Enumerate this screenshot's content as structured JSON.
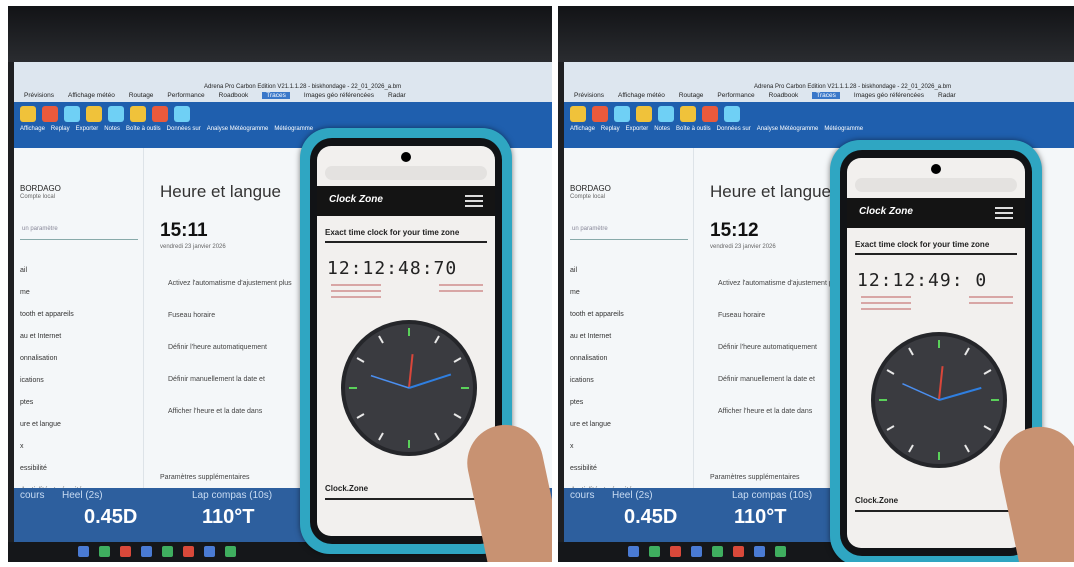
{
  "panels": [
    {
      "app_title": "Adrena Pro Carbon Edition V21.1.1.28 - biskhondage - 22_01_2026_a.bm",
      "menu_tabs": [
        "Prévisions",
        "Affichage météo",
        "Routage",
        "Performance",
        "Roadbook",
        "Traces",
        "Images géo référencées",
        "Radar"
      ],
      "active_tab": "Traces",
      "ribbon_labels": [
        "Affichage",
        "Replay",
        "Exporter",
        "Notes",
        "Boîte à outils",
        "Données sur",
        "Analyse Météogramme",
        "Météogramme"
      ],
      "account_name": "BORDAGO",
      "account_sub": "Compte local",
      "search_placeholder": "un paramètre",
      "nav_items": [
        "ail",
        "me",
        "tooth et appareils",
        "au et Internet",
        "onnalisation",
        "ications",
        "ptes",
        "ure et langue",
        "x",
        "essibilité",
        "dentialité et sécurité"
      ],
      "page_title": "Heure et langue",
      "clock_time": "15:11",
      "date_text": "vendredi 23 janvier 2026",
      "settings_rows": [
        "Activez l'automatisme d'ajustement plus",
        "Fuseau horaire",
        "Définir l'heure automatiquement",
        "Définir manuellement la date et",
        "Afficher l'heure et la date dans"
      ],
      "extra_params": "Paramètres supplémentaires",
      "readout_labels": [
        "cours",
        "Heel (2s)",
        "Lap compas (10s)"
      ],
      "readout_values": [
        "0.45D",
        "110°T"
      ],
      "phone_logo": "Clock Zone",
      "phone_headline": "Exact time clock for your time zone",
      "phone_time": "12:12:48:70",
      "phone_footer": "Clock.Zone",
      "clock_angles": {
        "hour": 6,
        "minute": 72,
        "second": 288
      }
    },
    {
      "app_title": "Adrena Pro Carbon Edition V21.1.1.28 - biskhondage - 22_01_2026_a.bm",
      "menu_tabs": [
        "Prévisions",
        "Affichage météo",
        "Routage",
        "Performance",
        "Roadbook",
        "Traces",
        "Images géo référencées",
        "Radar"
      ],
      "active_tab": "Traces",
      "ribbon_labels": [
        "Affichage",
        "Replay",
        "Exporter",
        "Notes",
        "Boîte à outils",
        "Données sur",
        "Analyse Météogramme",
        "Météogramme"
      ],
      "account_name": "BORDAGO",
      "account_sub": "Compte local",
      "search_placeholder": "un paramètre",
      "nav_items": [
        "ail",
        "me",
        "tooth et appareils",
        "au et Internet",
        "onnalisation",
        "ications",
        "ptes",
        "ure et langue",
        "x",
        "essibilité",
        "dentialité et sécurité"
      ],
      "page_title": "Heure et langue",
      "clock_time": "15:12",
      "date_text": "vendredi 23 janvier 2026",
      "settings_rows": [
        "Activez l'automatisme d'ajustement plus",
        "Fuseau horaire",
        "Définir l'heure automatiquement",
        "Définir manuellement la date et",
        "Afficher l'heure et la date dans"
      ],
      "extra_params": "Paramètres supplémentaires",
      "readout_labels": [
        "cours",
        "Heel (2s)",
        "Lap compas (10s)"
      ],
      "readout_values": [
        "0.45D",
        "110°T"
      ],
      "phone_logo": "Clock Zone",
      "phone_headline": "Exact time clock for your time zone",
      "phone_time": "12:12:49: 0",
      "phone_footer": "Clock.Zone",
      "clock_angles": {
        "hour": 6,
        "minute": 74,
        "second": 294
      }
    }
  ],
  "colors": {
    "phone_case": "#2fa6c2",
    "ribbon": "#1f5fae",
    "readout_bar": "#2d5f9e",
    "hour_hand": "#d9463a",
    "minute_hand": "#2f7fe0",
    "tick_green": "#5ad15a"
  }
}
